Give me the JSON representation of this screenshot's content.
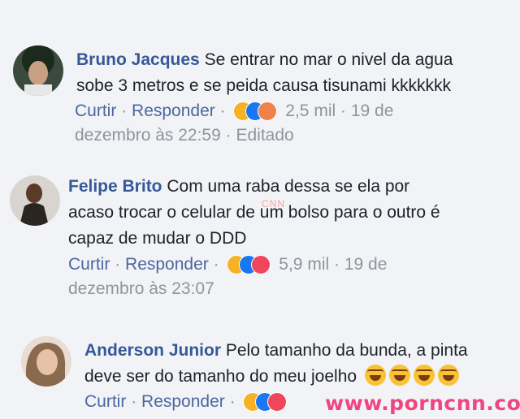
{
  "comments": [
    {
      "author": "Bruno Jacques",
      "text_line1": "Se entrar no mar o nivel da agua",
      "text_line2": "sobe 3 metros e se peida causa tisunami kkkkkkk",
      "like": "Curtir",
      "reply": "Responder",
      "reactions_icons": [
        "haha-icon",
        "like-icon",
        "angry-icon"
      ],
      "reaction_count": "2,5 mil",
      "date_part1": "19 de",
      "date_part2": "dezembro às 22:59",
      "edited": "Editado"
    },
    {
      "author": "Felipe Brito",
      "text_line1": "Com uma raba dessa se ela por",
      "text_line2": "acaso trocar o celular de um bolso para o outro é",
      "text_line3": "capaz de mudar o DDD",
      "like": "Curtir",
      "reply": "Responder",
      "reactions_icons": [
        "haha-icon",
        "like-icon",
        "love-icon"
      ],
      "reaction_count": "5,9 mil",
      "date_part1": "19 de",
      "date_part2": "dezembro às 23:07"
    },
    {
      "author": "Anderson Junior",
      "text_line1": "Pelo tamanho da bunda, a pinta",
      "text_line2": "deve ser do tamanho do meu joelho",
      "emoji_icons": [
        "tears-of-joy-icon",
        "tears-of-joy-icon",
        "tears-of-joy-icon",
        "tears-of-joy-icon"
      ],
      "like": "Curtir",
      "reply": "Responder",
      "reactions_icons": [
        "haha-icon",
        "like-icon",
        "love-icon"
      ]
    }
  ],
  "watermark": "www.porncnn.com",
  "watermark_small": "CNN"
}
